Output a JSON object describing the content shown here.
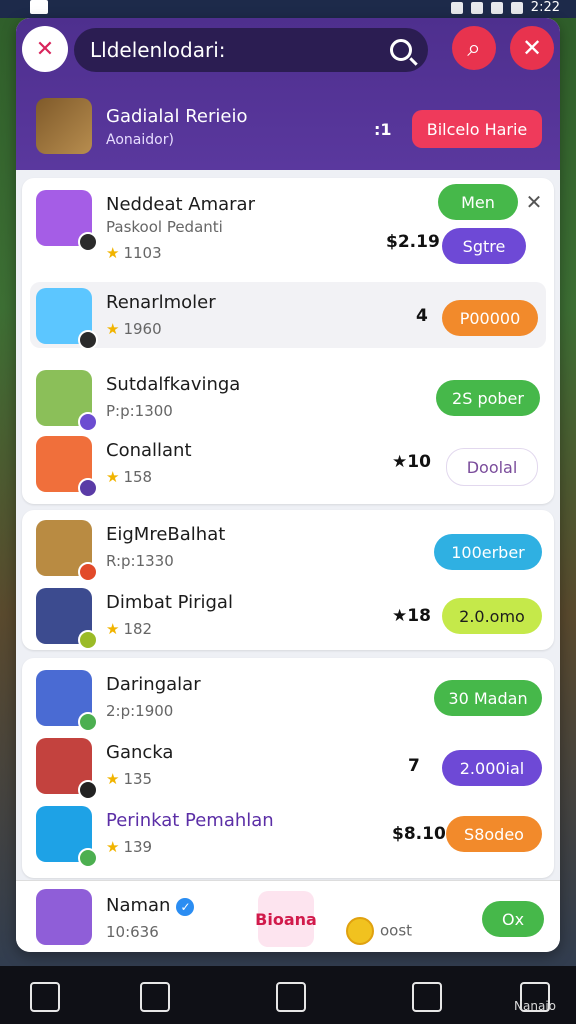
{
  "status": {
    "time": "2:22"
  },
  "header": {
    "search_text": "Lldelenlodari:",
    "icons": {
      "logo": "logo-icon",
      "search": "search-icon",
      "qr": "qr-icon",
      "close": "close-icon"
    }
  },
  "user": {
    "name": "Gadialal Rerieio",
    "sub": "Aonaidor)",
    "count": ":1",
    "action": "Bilcelo Harie"
  },
  "cards": [
    {
      "rows": [
        {
          "title": "Neddeat Amarar",
          "subtitle": "Paskool Pedanti",
          "rating": "1103",
          "price": "$2.19",
          "button": "Sgtre",
          "button_color": "purple",
          "extra": "Men",
          "highlight": false,
          "avatar": "#a55de6"
        },
        {
          "title": "Renarlmoler",
          "subtitle": "",
          "rating": "1960",
          "price": "4",
          "button": "P00000",
          "button_color": "orange",
          "highlight": true,
          "avatar": "#5cc6ff"
        },
        {
          "title": "Sutdalfkavinga",
          "subtitle": "P:p:1300",
          "rating": "",
          "price": "",
          "button": "2S pober",
          "button_color": "green",
          "highlight": false,
          "avatar": "#8bbf59"
        },
        {
          "title": "Conallant",
          "subtitle": "",
          "rating": "158",
          "price": "★10",
          "button": "Doolal",
          "button_color": "outline",
          "highlight": false,
          "avatar": "#f06f3b"
        }
      ]
    },
    {
      "rows": [
        {
          "title": "EigMreBalhat",
          "subtitle": "R:p:1330",
          "rating": "",
          "price": "",
          "button": "100erber",
          "button_color": "blue",
          "highlight": false,
          "avatar": "#b98b42"
        },
        {
          "title": "Dimbat Pirigal",
          "subtitle": "",
          "rating": "182",
          "price": "★18",
          "button": "2.0.omo",
          "button_color": "lime",
          "highlight": false,
          "avatar": "#3c4b8f"
        }
      ]
    },
    {
      "rows": [
        {
          "title": "Daringalar",
          "subtitle": "2:p:1900",
          "rating": "",
          "price": "",
          "button": "30 Madan",
          "button_color": "green",
          "highlight": false,
          "avatar": "#4a6bd3"
        },
        {
          "title": "Gancka",
          "subtitle": "",
          "rating": "135",
          "price": "7",
          "button": "2.000ial",
          "button_color": "purple",
          "highlight": false,
          "avatar": "#c3423e"
        },
        {
          "title": "Perinkat Pemahlan",
          "subtitle": "",
          "rating": "139",
          "price": "$8.10",
          "button": "S8odeo",
          "button_color": "orange",
          "highlight": false,
          "avatar": "#1ea2e6"
        }
      ]
    }
  ],
  "bottom": {
    "name": "Naman",
    "sub": "10:636",
    "brand": "Bioana",
    "coins_label": "oost",
    "ok_label": "Ox"
  },
  "navbar": {
    "items": [
      "home-icon",
      "message-icon",
      "house-icon",
      "square-icon",
      "search-icon"
    ],
    "last_label": "Nanaio"
  }
}
